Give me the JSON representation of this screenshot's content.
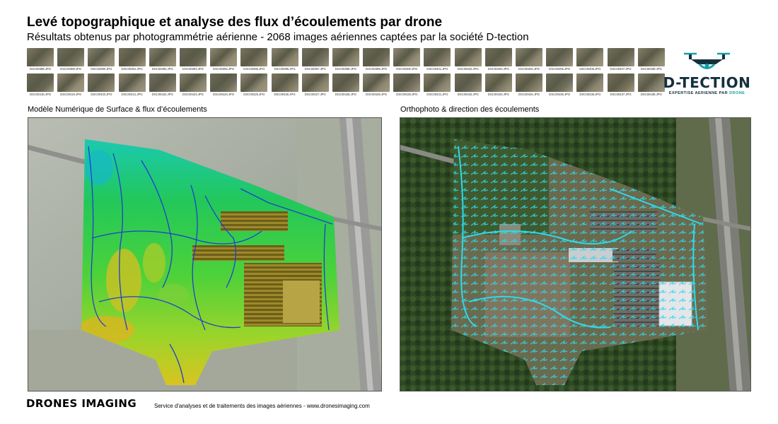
{
  "header": {
    "title": "Levé topographique et analyse des flux d’écoulements par drone",
    "subtitle": "Résultats obtenus par photogrammétrie aérienne - 2068 images aériennes captées par la société D-tection"
  },
  "thumbnails": {
    "row1": [
      "DSC00388.JPG",
      "DSC00389.JPG",
      "DSC00390.JPG",
      "DSC00391.JPG",
      "DSC00392.JPG",
      "DSC00393.JPG",
      "DSC00394.JPG",
      "DSC00395.JPG",
      "DSC00396.JPG",
      "DSC00397.JPG",
      "DSC00398.JPG",
      "DSC00399.JPG",
      "DSC00400.JPG",
      "DSC00401.JPG",
      "DSC00402.JPG",
      "DSC00403.JPG",
      "DSC00404.JPG",
      "DSC00405.JPG",
      "DSC00406.JPG",
      "DSC00407.JPG",
      "DSC00408.JPG"
    ],
    "row2": [
      "DSC00418.JPG",
      "DSC00419.JPG",
      "DSC00420.JPG",
      "DSC00421.JPG",
      "DSC00422.JPG",
      "DSC00423.JPG",
      "DSC00424.JPG",
      "DSC00425.JPG",
      "DSC00426.JPG",
      "DSC00427.JPG",
      "DSC00428.JPG",
      "DSC00429.JPG",
      "DSC00430.JPG",
      "DSC00431.JPG",
      "DSC00432.JPG",
      "DSC00433.JPG",
      "DSC00434.JPG",
      "DSC00435.JPG",
      "DSC00436.JPG",
      "DSC00437.JPG",
      "DSC00438.JPG"
    ]
  },
  "logo": {
    "name": "D-TECTION",
    "tagline_main": "EXPERTISE AERIENNE PAR ",
    "tagline_accent": "DRONE",
    "colors": {
      "dark": "#15303d",
      "accent": "#13a2a6"
    }
  },
  "panels": {
    "left_label": "Modèle Numérique de Surface & flux d’écoulements",
    "right_label": "Orthophoto & direction des écoulements"
  },
  "footer": {
    "brand": "DRONES IMAGING",
    "text": "Service d'analyses et de traitements des images aériennes - www.dronesimaging.com"
  }
}
